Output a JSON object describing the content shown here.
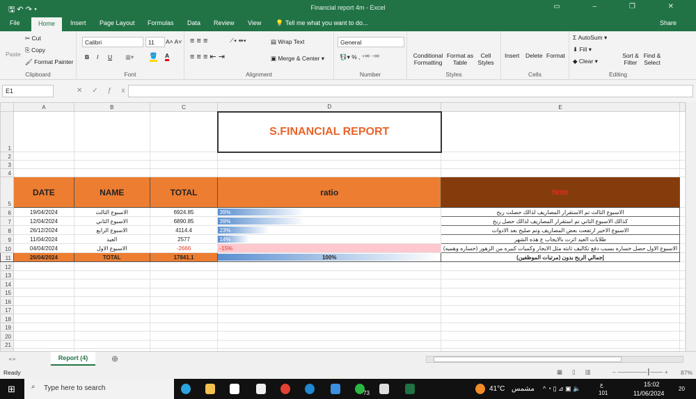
{
  "window": {
    "title": "Financial report 4m - Excel"
  },
  "tabs": [
    "File",
    "Home",
    "Insert",
    "Page Layout",
    "Formulas",
    "Data",
    "Review",
    "View"
  ],
  "tell_me": "Tell me what you want to do...",
  "share": "Share",
  "ribbon": {
    "clipboard": {
      "paste": "Paste",
      "cut": "Cut",
      "copy": "Copy",
      "format_painter": "Format Painter",
      "label": "Clipboard"
    },
    "font": {
      "name": "Calibri",
      "size": "11",
      "label": "Font",
      "bold": "B",
      "italic": "I",
      "underline": "U"
    },
    "alignment": {
      "wrap": "Wrap Text",
      "merge": "Merge & Center",
      "label": "Alignment"
    },
    "number": {
      "format": "General",
      "label": "Number"
    },
    "styles": {
      "conditional": "Conditional Formatting",
      "format_table": "Format as Table",
      "cell_styles": "Cell Styles",
      "label": "Styles"
    },
    "cells": {
      "insert": "Insert",
      "delete": "Delete",
      "format": "Format",
      "label": "Cells"
    },
    "editing": {
      "autosum": "AutoSum",
      "fill": "Fill",
      "clear": "Clear",
      "sort": "Sort & Filter",
      "find": "Find & Select",
      "label": "Editing"
    }
  },
  "name_box": "E1",
  "columns": [
    "A",
    "B",
    "C",
    "D",
    "E"
  ],
  "report_title": "S.FINANCIAL REPORT",
  "headers": {
    "date": "DATE",
    "name": "NAME",
    "total": "TOTAL",
    "ratio": "ratio",
    "note": "Note"
  },
  "rows": [
    {
      "date": "19/04/2024",
      "name": "الاسبوع الثالث",
      "total": "6924.85",
      "ratio_label": "39%",
      "ratio": 39,
      "note": "الاسبوع الثالث تم الاستقرار المصاريف لذالك حصلت ربح"
    },
    {
      "date": "12/04/2024",
      "name": "الاسبوع الثاني",
      "total": "6890.85",
      "ratio_label": "39%",
      "ratio": 39,
      "note": "كذالك الاسبوع الثاني تم استقرار المصاريف لذالك حصل ربح"
    },
    {
      "date": "26/12/2024",
      "name": "الاسبوع الرابع",
      "total": "4114.4",
      "ratio_label": "23%",
      "ratio": 23,
      "note": "الاسبوع الاخير ارتفعت بعض المصاريف وتم صليح بعد الادوات"
    },
    {
      "date": "11/04/2024",
      "name": "العيد",
      "total": "2577",
      "ratio_label": "14%",
      "ratio": 14,
      "note": "طلابات العيد اثرت بالايجاب ع هذه الشهر"
    },
    {
      "date": "04/04/2024",
      "name": "الاسبوع الاول",
      "total": "-2666",
      "ratio_label": "-15%",
      "ratio": -15,
      "note": "الاسبوع الاول حصل خساره بسبب دفع تكاليف ثابته مثل الايجار وكميات كبيره من الزهور (خساره وهميه)"
    }
  ],
  "total_row": {
    "date": "26/04/2024",
    "name": "TOTAL",
    "total": "17841.1",
    "ratio_label": "100%",
    "ratio": 100,
    "note": "إجمالي الربح بدون (مرتبات الموظفين)"
  },
  "sheet_tab": "Report (4)",
  "status": {
    "ready": "Ready",
    "zoom": "87%"
  },
  "taskbar": {
    "search": "Type here to search",
    "weather": "41°C",
    "weather_text": "مشمس",
    "time": "15:02",
    "date": "11/06/2024",
    "lang": "ع",
    "notif": "20",
    "badge": "73",
    "kbd": "101"
  }
}
